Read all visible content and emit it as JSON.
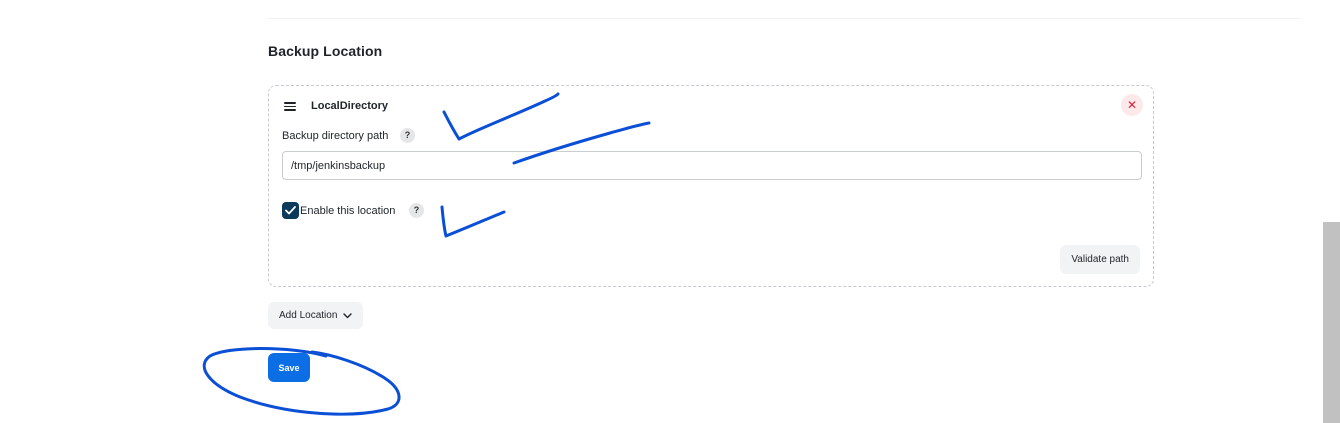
{
  "section": {
    "title": "Backup Location"
  },
  "location_card": {
    "type_title": "LocalDirectory",
    "path_label": "Backup directory path",
    "path_value": "/tmp/jenkinsbackup",
    "enable_label": "Enable this location",
    "enable_checked": true,
    "validate_label": "Validate path",
    "help_glyph": "?",
    "delete_glyph": "✕"
  },
  "actions": {
    "add_location_label": "Add Location",
    "save_label": "Save"
  },
  "colors": {
    "primary": "#0b6ee4",
    "checkbox": "#0c3a5a",
    "danger": "#d8243a",
    "annotation": "#0a4fd6"
  },
  "icons": {
    "drag": "drag-handle-icon",
    "delete": "close-icon",
    "help": "help-icon",
    "check": "checkmark-icon",
    "dropdown": "chevron-down-icon"
  }
}
